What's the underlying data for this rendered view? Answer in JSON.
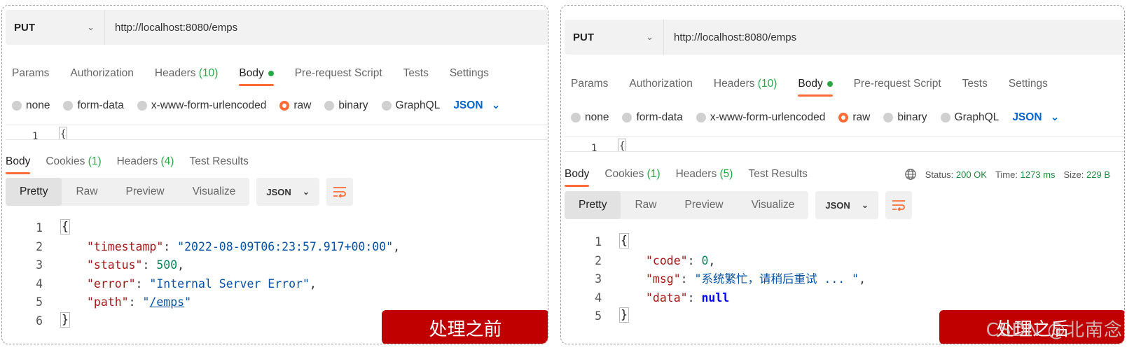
{
  "panels": [
    {
      "method": "PUT",
      "url": "http://localhost:8080/emps",
      "request_tabs": {
        "params": "Params",
        "authorization": "Authorization",
        "headers": "Headers",
        "headers_count": "(10)",
        "body": "Body",
        "prerequest": "Pre-request Script",
        "tests": "Tests",
        "settings": "Settings"
      },
      "body_types": {
        "none": "none",
        "form_data": "form-data",
        "urlencoded": "x-www-form-urlencoded",
        "raw": "raw",
        "binary": "binary",
        "graphql": "GraphQL",
        "format": "JSON"
      },
      "editor": {
        "line": "1",
        "text": "{"
      },
      "response_tabs": {
        "body": "Body",
        "cookies": "Cookies",
        "cookies_count": "(1)",
        "headers": "Headers",
        "headers_count": "(4)",
        "test_results": "Test Results"
      },
      "view_modes": {
        "pretty": "Pretty",
        "raw": "Raw",
        "preview": "Preview",
        "visualize": "Visualize",
        "format": "JSON"
      },
      "code": {
        "n1": "1",
        "n2": "2",
        "n3": "3",
        "n4": "4",
        "n5": "5",
        "n6": "6",
        "open": "{",
        "close": "}",
        "l2_key": "\"timestamp\"",
        "l2_val": "\"2022-08-09T06:23:57.917+00:00\"",
        "l3_key": "\"status\"",
        "l3_val": "500",
        "l4_key": "\"error\"",
        "l4_val": "\"Internal Server Error\"",
        "l5_key": "\"path\"",
        "l5_val_link": "/emps"
      },
      "badge": "处理之前"
    },
    {
      "method": "PUT",
      "url": "http://localhost:8080/emps",
      "request_tabs": {
        "params": "Params",
        "authorization": "Authorization",
        "headers": "Headers",
        "headers_count": "(10)",
        "body": "Body",
        "prerequest": "Pre-request Script",
        "tests": "Tests",
        "settings": "Settings"
      },
      "body_types": {
        "none": "none",
        "form_data": "form-data",
        "urlencoded": "x-www-form-urlencoded",
        "raw": "raw",
        "binary": "binary",
        "graphql": "GraphQL",
        "format": "JSON"
      },
      "editor": {
        "line": "1",
        "text": "{"
      },
      "response_tabs": {
        "body": "Body",
        "cookies": "Cookies",
        "cookies_count": "(1)",
        "headers": "Headers",
        "headers_count": "(5)",
        "test_results": "Test Results"
      },
      "status": {
        "status_label": "Status:",
        "status_value": "200 OK",
        "time_label": "Time:",
        "time_value": "1273 ms",
        "size_label": "Size:",
        "size_value": "229 B"
      },
      "view_modes": {
        "pretty": "Pretty",
        "raw": "Raw",
        "preview": "Preview",
        "visualize": "Visualize",
        "format": "JSON"
      },
      "code": {
        "n1": "1",
        "n2": "2",
        "n3": "3",
        "n4": "4",
        "n5": "5",
        "open": "{",
        "close": "}",
        "l2_key": "\"code\"",
        "l2_val": "0",
        "l3_key": "\"msg\"",
        "l3_val": "\"系统繁忙，请稍后重试 ... \"",
        "l4_key": "\"data\"",
        "l4_val": "null"
      },
      "badge": "处理之后"
    }
  ],
  "watermark": "CSDN @北南念",
  "colors": {
    "accent": "#ff6c37",
    "badge": "#c00000",
    "count_green": "#28a745",
    "json_blue": "#0265d2"
  }
}
